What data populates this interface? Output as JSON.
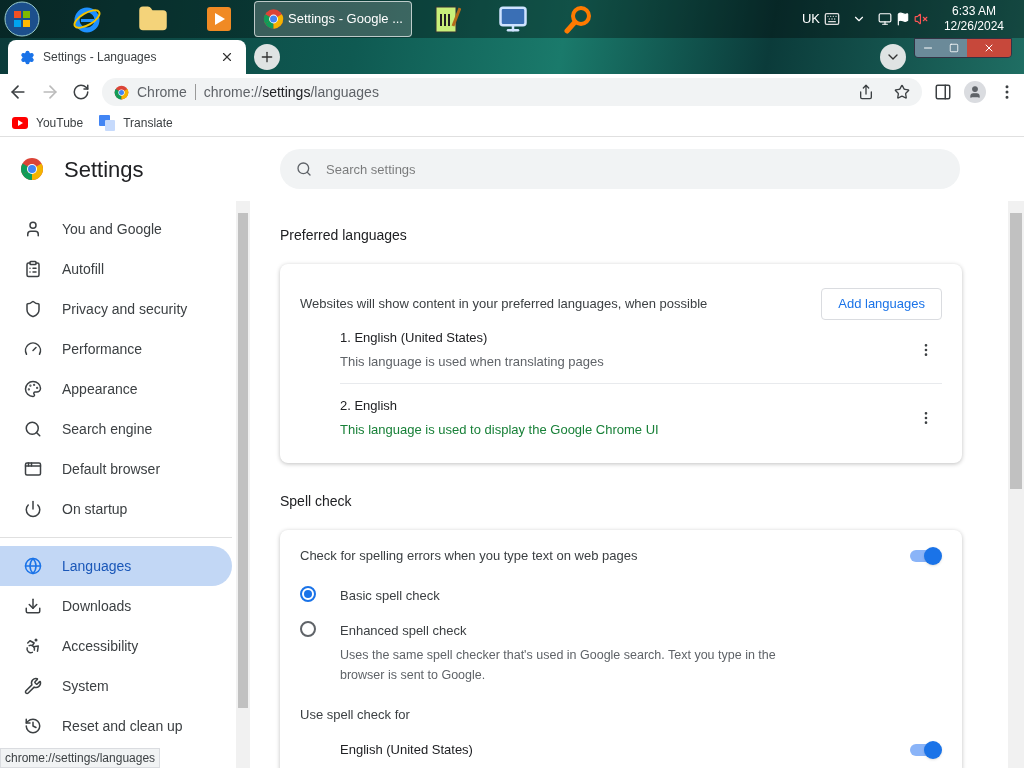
{
  "taskbar": {
    "apps": [
      {
        "kind": "ie",
        "active": false
      },
      {
        "kind": "folder",
        "active": false
      },
      {
        "kind": "media",
        "active": false
      },
      {
        "kind": "chrome",
        "active": true,
        "label": "Settings - Google ..."
      },
      {
        "kind": "notepad",
        "active": false
      },
      {
        "kind": "network",
        "active": false
      },
      {
        "kind": "search",
        "active": false
      }
    ],
    "language": "UK",
    "time": "6:33 AM",
    "date": "12/26/2024"
  },
  "tab": {
    "title": "Settings - Languages"
  },
  "address": {
    "site": "Chrome",
    "url_host": "chrome://",
    "url_path": "settings",
    "url_rest": "/languages"
  },
  "bookmarks": [
    {
      "kind": "youtube",
      "label": "YouTube"
    },
    {
      "kind": "translate",
      "label": "Translate"
    }
  ],
  "settings": {
    "title": "Settings",
    "search_placeholder": "Search settings"
  },
  "sidebar": {
    "items": [
      {
        "label": "You and Google",
        "selected": false
      },
      {
        "label": "Autofill",
        "selected": false
      },
      {
        "label": "Privacy and security",
        "selected": false
      },
      {
        "label": "Performance",
        "selected": false
      },
      {
        "label": "Appearance",
        "selected": false
      },
      {
        "label": "Search engine",
        "selected": false
      },
      {
        "label": "Default browser",
        "selected": false
      },
      {
        "label": "On startup",
        "selected": false
      },
      {
        "label": "Languages",
        "selected": true
      },
      {
        "label": "Downloads",
        "selected": false
      },
      {
        "label": "Accessibility",
        "selected": false
      },
      {
        "label": "System",
        "selected": false
      },
      {
        "label": "Reset and clean up",
        "selected": false
      }
    ]
  },
  "preferred": {
    "heading": "Preferred languages",
    "description": "Websites will show content in your preferred languages, when possible",
    "add_button": "Add languages",
    "languages": [
      {
        "name": "1. English (United States)",
        "note": "This language is used when translating pages",
        "highlight": false
      },
      {
        "name": "2. English",
        "note": "This language is used to display the Google Chrome UI",
        "highlight": true
      }
    ]
  },
  "spell_check": {
    "heading": "Spell check",
    "toggle_label": "Check for spelling errors when you type text on web pages",
    "on": true,
    "options": [
      {
        "label": "Basic spell check",
        "selected": true
      },
      {
        "label": "Enhanced spell check",
        "description": "Uses the same spell checker that's used in Google search. Text you type in the browser is sent to Google.",
        "selected": false
      }
    ],
    "use_for_label": "Use spell check for",
    "languages": [
      {
        "name": "English (United States)",
        "on": true
      }
    ]
  },
  "status_url": "chrome://settings/languages"
}
